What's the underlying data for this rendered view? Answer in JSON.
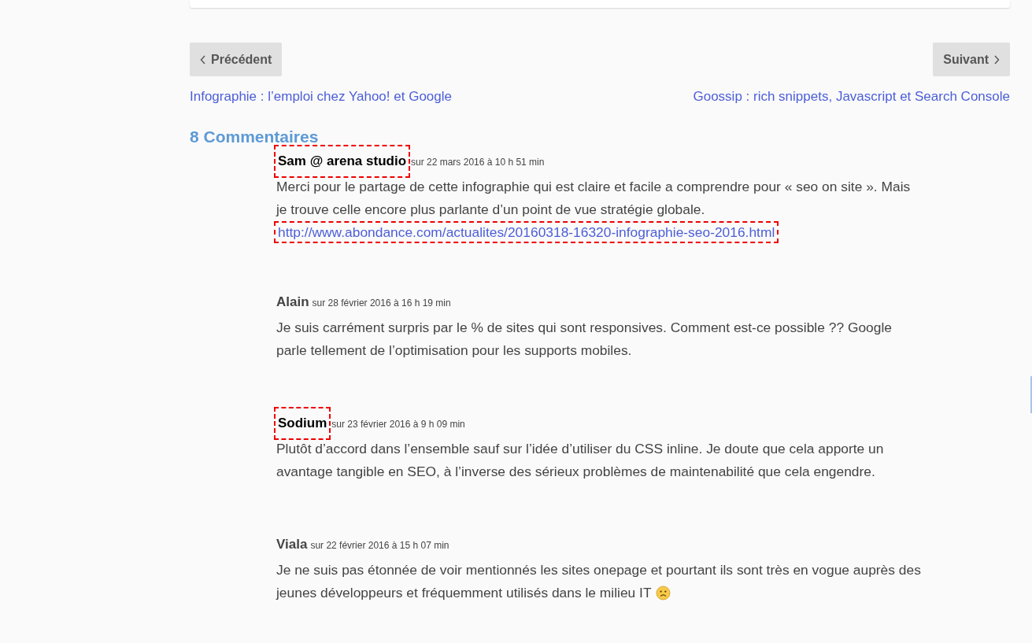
{
  "navigation": {
    "previous": {
      "label": "Précédent",
      "title": "Infographie : l’emploi chez Yahoo! et Google"
    },
    "next": {
      "label": "Suivant",
      "title": "Goossip : rich snippets, Javascript et Search Console"
    }
  },
  "comments": {
    "heading": "8 Commentaires",
    "items": [
      {
        "author": "Sam @ arena studio",
        "author_highlighted": true,
        "date": "sur 22 mars 2016 à 10 h 51 min",
        "body": "Merci pour le partage de cette infographie qui est claire et facile a comprendre pour « seo on site ». Mais je trouve celle encore plus parlante d’un point de vue stratégie globale.",
        "link": {
          "text": "http://www.abondance.com/actualites/20160318-16320-infographie-seo-2016.html",
          "highlighted": true
        }
      },
      {
        "author": "Alain",
        "author_highlighted": false,
        "date": "sur 28 février 2016 à 16 h 19 min",
        "body": "Je suis carrément surpris par le % de sites qui sont responsives. Comment est-ce possible ?? Google parle tellement de l’optimisation pour les supports mobiles."
      },
      {
        "author": "Sodium",
        "author_highlighted": true,
        "date": "sur 23 février 2016 à 9 h 09 min",
        "body": "Plutôt d’accord dans l’ensemble sauf sur l’idée d’utiliser du CSS inline. Je doute que cela apporte un avantage tangible en SEO, à l’inverse des sérieux problèmes de maintenabilité que cela engendre."
      },
      {
        "author": "Viala",
        "author_highlighted": false,
        "date": "sur 22 février 2016 à 15 h 07 min",
        "body": "Je ne suis pas étonnée de voir mentionnés les sites onepage et pourtant ils sont très en vogue auprès des jeunes développeurs et fréquemment utilisés dans le milieu IT",
        "trailing_emoji": true
      }
    ]
  }
}
